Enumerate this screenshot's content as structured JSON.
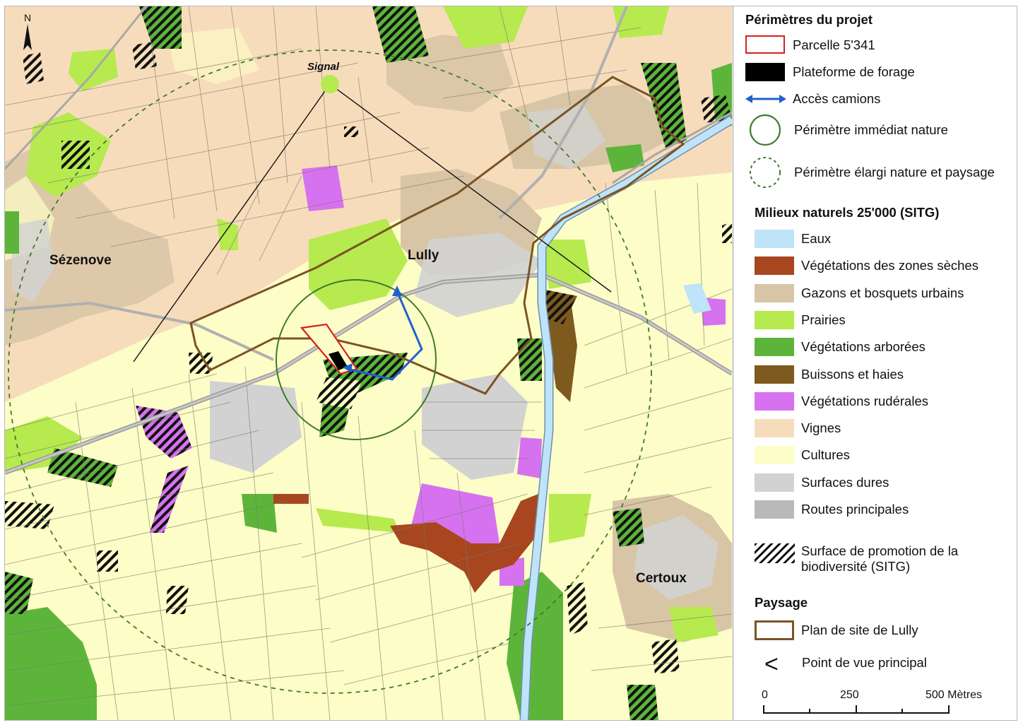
{
  "map": {
    "places": {
      "sezenove": "Sézenove",
      "lully": "Lully",
      "certoux": "Certoux",
      "signal": "Signal",
      "north": "N"
    },
    "colors": {
      "cultures": "#fdfdc7",
      "vignes": "#f7dcbb",
      "gazons": "#d8c5a6",
      "prairies": "#b6ea4f",
      "arborees": "#5cb53a",
      "buissons": "#7e5a1e",
      "ruderales": "#d672f0",
      "seches": "#a8461f",
      "surfaces_dures": "#d2d2d2",
      "routes": "#b9b9b9",
      "eaux": "#bfe3f8",
      "plan_site": "#7a5424",
      "parcelle": "#d42020",
      "acces": "#2060d0",
      "perimetre": "#3f7a2b"
    }
  },
  "legend": {
    "section1_title": "Périmètres du projet",
    "parcelle": "Parcelle 5'341",
    "plateforme": "Plateforme de forage",
    "acces": "Accès camions",
    "perim_immediat": "Périmètre immédiat nature",
    "perim_elargi": "Périmètre élargi nature et paysage",
    "section2_title": "Milieux naturels 25'000 (SITG)",
    "milieux": [
      {
        "label": "Eaux",
        "color": "#bfe3f8"
      },
      {
        "label": "Végétations des zones sèches",
        "color": "#a8461f"
      },
      {
        "label": "Gazons et bosquets urbains",
        "color": "#d8c5a6"
      },
      {
        "label": "Prairies",
        "color": "#b6ea4f"
      },
      {
        "label": "Végétations arborées",
        "color": "#5cb53a"
      },
      {
        "label": "Buissons et haies",
        "color": "#7e5a1e"
      },
      {
        "label": "Végétations rudérales",
        "color": "#d672f0"
      },
      {
        "label": "Vignes",
        "color": "#f7dcbb"
      },
      {
        "label": "Cultures",
        "color": "#fdfdc7"
      },
      {
        "label": "Surfaces dures",
        "color": "#d2d2d2"
      },
      {
        "label": "Routes principales",
        "color": "#b9b9b9"
      }
    ],
    "biodiversite": "Surface de promotion de la biodiversité (SITG)",
    "section3_title": "Paysage",
    "plan_site": "Plan de site de Lully",
    "point_vue_symbol": "<",
    "point_vue": "Point de vue principal",
    "scale": {
      "zero": "0",
      "mid": "250",
      "end": "500 Mètres"
    }
  }
}
